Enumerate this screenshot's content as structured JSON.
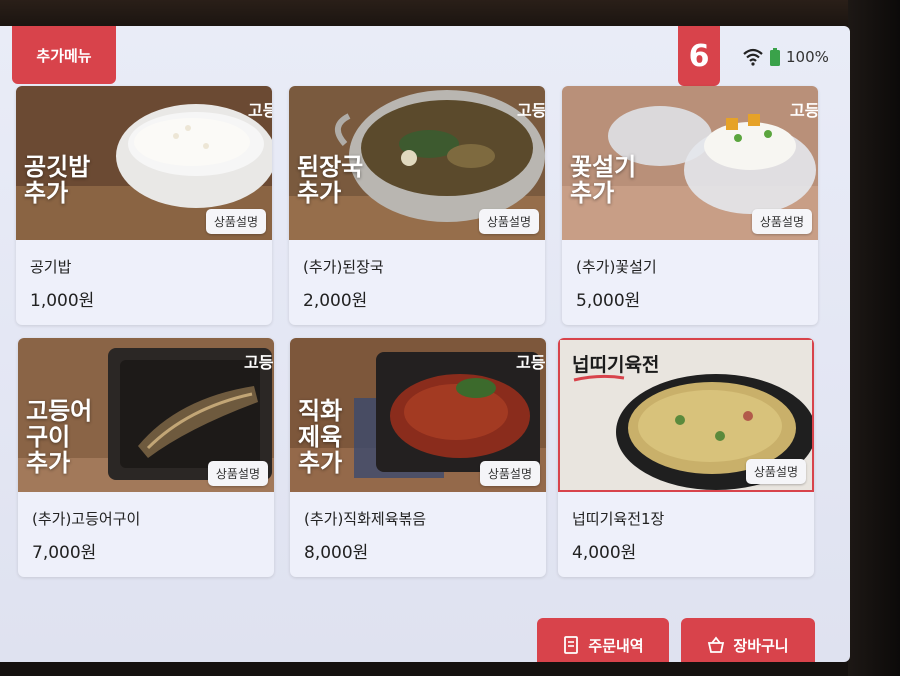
{
  "header": {
    "menu_tab_label": "추가메뉴",
    "table_number": "6",
    "battery_percent": "100%",
    "wifi_icon": "wifi-icon",
    "battery_icon": "battery-icon"
  },
  "items": [
    {
      "overlay": "공깃밥\n추가",
      "name": "공기밥",
      "price": "1,000원",
      "desc_label": "상품설명"
    },
    {
      "overlay": "된장국\n추가",
      "name": "(추가)된장국",
      "price": "2,000원",
      "desc_label": "상품설명"
    },
    {
      "overlay": "꽃설기\n추가",
      "name": "(추가)꽃설기",
      "price": "5,000원",
      "desc_label": "상품설명"
    },
    {
      "overlay": "고등어\n구이\n추가",
      "name": "(추가)고등어구이",
      "price": "7,000원",
      "desc_label": "상품설명"
    },
    {
      "overlay": "직화\n제육\n추가",
      "name": "(추가)직화제육볶음",
      "price": "8,000원",
      "desc_label": "상품설명"
    },
    {
      "overlay": "넙띠기육전",
      "name": "넙띠기육전1장",
      "price": "4,000원",
      "desc_label": "상품설명"
    }
  ],
  "footer": {
    "order_history_label": "주문내역",
    "cart_label": "장바구니"
  },
  "colors": {
    "accent": "#d8434b",
    "background": "#e6e9f5"
  }
}
